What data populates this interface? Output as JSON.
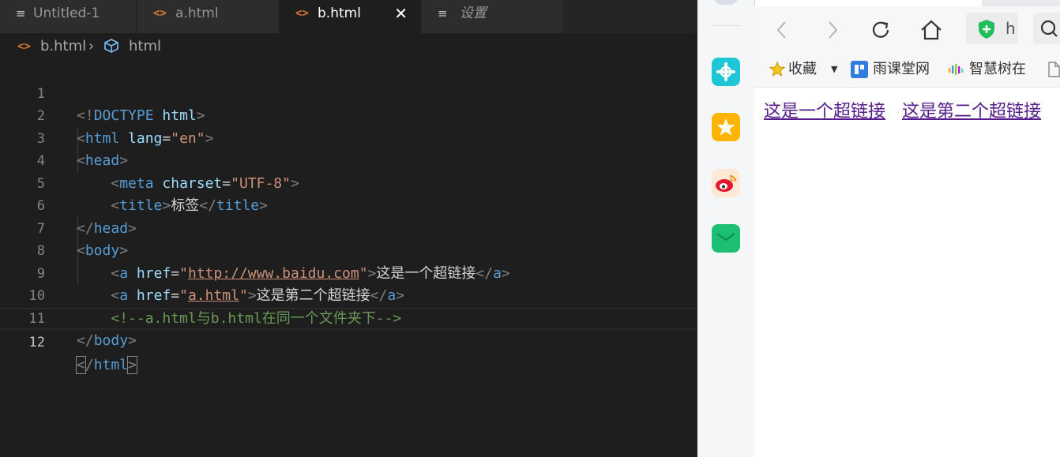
{
  "editor": {
    "tabs": [
      {
        "label": "Untitled-1",
        "icon": "lines-icon"
      },
      {
        "label": "a.html",
        "icon": "code-icon"
      },
      {
        "label": "b.html",
        "icon": "code-icon",
        "active": true
      },
      {
        "label": "设置",
        "icon": "lines-icon"
      }
    ],
    "close_glyph": "✕",
    "breadcrumb": {
      "file": "b.html",
      "separator": "›",
      "symbol": "html"
    },
    "lines": [
      {
        "n": "1"
      },
      {
        "n": "2"
      },
      {
        "n": "3"
      },
      {
        "n": "4"
      },
      {
        "n": "5"
      },
      {
        "n": "6"
      },
      {
        "n": "7"
      },
      {
        "n": "8"
      },
      {
        "n": "9"
      },
      {
        "n": "10"
      },
      {
        "n": "11"
      },
      {
        "n": "12"
      }
    ],
    "code": {
      "doctype": "DOCTYPE",
      "html_tag": "html",
      "lang_attr": "lang",
      "lang_val": "\"en\"",
      "head": "head",
      "meta": "meta",
      "charset_attr": "charset",
      "charset_val": "\"UTF-8\"",
      "title": "title",
      "title_text": "标签",
      "body": "body",
      "a": "a",
      "href": "href",
      "href1": "http://www.baidu.com",
      "link1_text": "这是一个超链接",
      "href2": "a.html",
      "link2_text": "这是第二个超链接",
      "comment": "<!--a.html与b.html在同一个文件夹下-->"
    }
  },
  "browser": {
    "nav": {
      "back": "back-icon",
      "forward": "forward-icon",
      "reload": "reload-icon",
      "home": "home-icon",
      "address_partial": "h"
    },
    "bookmarks": [
      {
        "label": "收藏",
        "icon": "star-icon"
      },
      {
        "label": "雨课堂网",
        "icon": "yuketang-icon"
      },
      {
        "label": "智慧树在",
        "icon": "zhihuishu-icon"
      }
    ],
    "links": [
      "这是一个超链接",
      "这是第二个超链接"
    ],
    "visited_color": "#551a8b"
  }
}
